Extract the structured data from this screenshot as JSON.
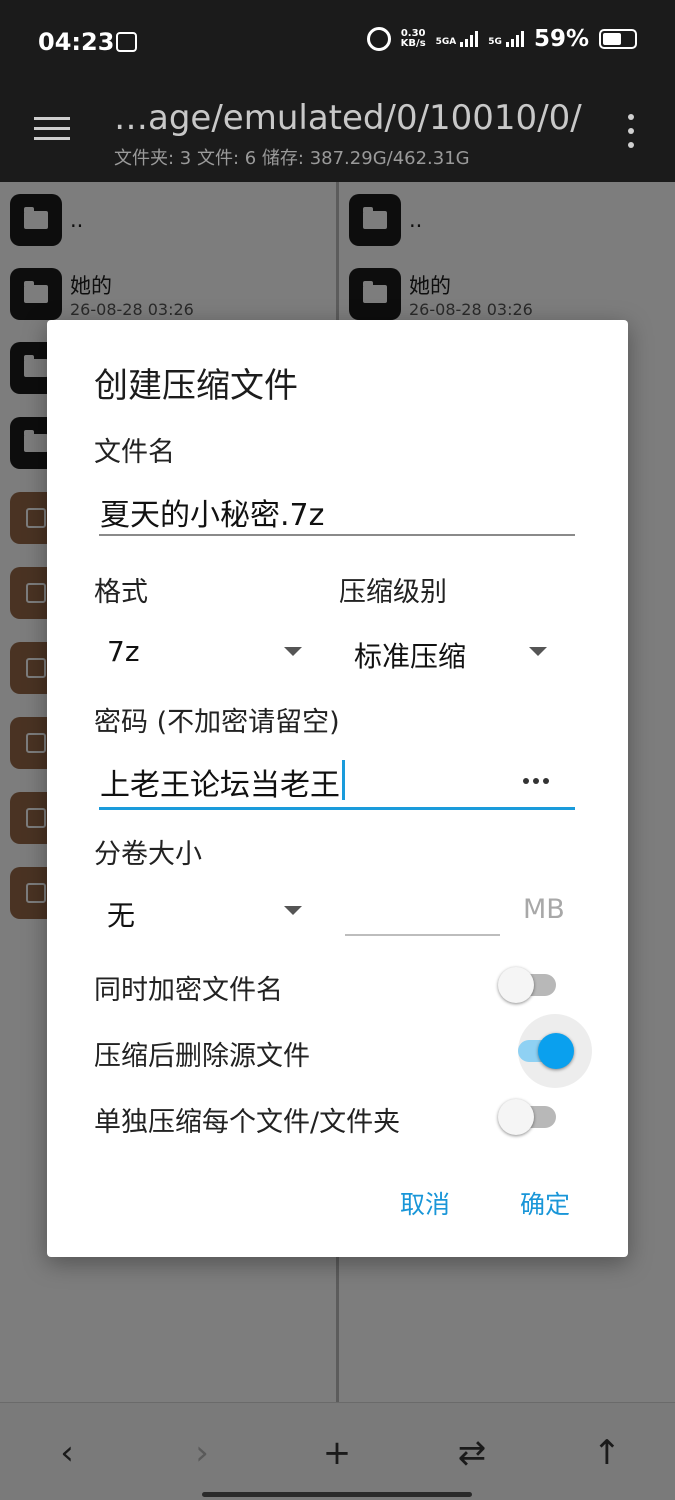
{
  "status_bar": {
    "time": "04:23",
    "speed_value": "0.30",
    "speed_unit": "KB/s",
    "net1": "5GA",
    "net2": "5G",
    "battery_percent": "59%",
    "battery_level": 0.59
  },
  "app_bar": {
    "path": "…age/emulated/0/10010/0/",
    "summary": "文件夹: 3  文件: 6  储存: 387.29G/462.31G"
  },
  "left_panel": {
    "parent": "..",
    "folder_name": "她的",
    "folder_date": "26-08-28 03:26"
  },
  "right_panel": {
    "parent": "..",
    "folder_name": "她的",
    "folder_date": "26-08-28 03:26"
  },
  "dialog": {
    "title": "创建压缩文件",
    "filename_label": "文件名",
    "filename_value": "夏天的小秘密.7z",
    "format_label": "格式",
    "format_value": "7z",
    "level_label": "压缩级别",
    "level_value": "标准压缩",
    "password_label": "密码 (不加密请留空)",
    "password_value": "上老王论坛当老王",
    "split_label": "分卷大小",
    "split_value": "无",
    "split_size_value": "",
    "split_unit": "MB",
    "option1_label": "同时加密文件名",
    "option1_on": false,
    "option2_label": "压缩后删除源文件",
    "option2_on": true,
    "option3_label": "单独压缩每个文件/文件夹",
    "option3_on": false,
    "cancel_label": "取消",
    "ok_label": "确定"
  },
  "bottom_bar": {
    "back": "‹",
    "forward": "›",
    "add": "+",
    "swap": "⇄",
    "up": "↑"
  },
  "colors": {
    "accent": "#1a9bdb",
    "switch_on": "#0aa0ee"
  }
}
